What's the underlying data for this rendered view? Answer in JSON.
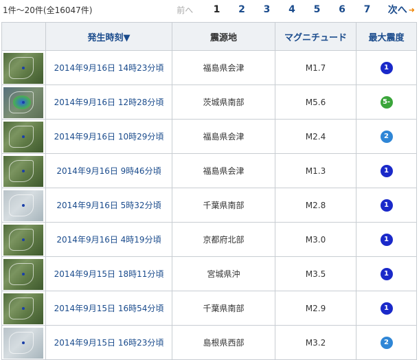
{
  "pagination": {
    "count_text": "1件～20件(全16047件)",
    "prev_label": "前へ",
    "pages": [
      "1",
      "2",
      "3",
      "4",
      "5",
      "6",
      "7"
    ],
    "current_page": "1",
    "next_label": "次へ",
    "next_arrow_icon": "orange-arrow-right-icon"
  },
  "table": {
    "headers": {
      "thumb": "",
      "time": "発生時刻▼",
      "epicenter": "震源地",
      "magnitude": "マグニチュード",
      "intensity": "最大震度"
    },
    "rows": [
      {
        "thumb_icon": "map-thumbnail-icon",
        "time": "2014年9月16日 14時23分頃",
        "epicenter": "福島県会津",
        "magnitude": "M1.7",
        "intensity": "1"
      },
      {
        "thumb_icon": "map-thumbnail-icon",
        "time": "2014年9月16日 12時28分頃",
        "epicenter": "茨城県南部",
        "magnitude": "M5.6",
        "intensity": "5-"
      },
      {
        "thumb_icon": "map-thumbnail-icon",
        "time": "2014年9月16日 10時29分頃",
        "epicenter": "福島県会津",
        "magnitude": "M2.4",
        "intensity": "2"
      },
      {
        "thumb_icon": "map-thumbnail-icon",
        "time": "2014年9月16日 9時46分頃",
        "epicenter": "福島県会津",
        "magnitude": "M1.3",
        "intensity": "1"
      },
      {
        "thumb_icon": "map-thumbnail-icon",
        "time": "2014年9月16日 5時32分頃",
        "epicenter": "千葉県南部",
        "magnitude": "M2.8",
        "intensity": "1"
      },
      {
        "thumb_icon": "map-thumbnail-icon",
        "time": "2014年9月16日 4時19分頃",
        "epicenter": "京都府北部",
        "magnitude": "M3.0",
        "intensity": "1"
      },
      {
        "thumb_icon": "map-thumbnail-icon",
        "time": "2014年9月15日 18時11分頃",
        "epicenter": "宮城県沖",
        "magnitude": "M3.5",
        "intensity": "1"
      },
      {
        "thumb_icon": "map-thumbnail-icon",
        "time": "2014年9月15日 16時54分頃",
        "epicenter": "千葉県南部",
        "magnitude": "M2.9",
        "intensity": "1"
      },
      {
        "thumb_icon": "map-thumbnail-icon",
        "time": "2014年9月15日 16時23分頃",
        "epicenter": "島根県西部",
        "magnitude": "M3.2",
        "intensity": "2"
      }
    ]
  },
  "colors": {
    "link": "#1a4b8c",
    "header_bg": "#eef1f4",
    "border": "#c8cdd2",
    "intensity_1": "#1a29c9",
    "intensity_2": "#2f86d6",
    "intensity_5minus": "#3aa53a",
    "next_arrow": "#f08300"
  }
}
